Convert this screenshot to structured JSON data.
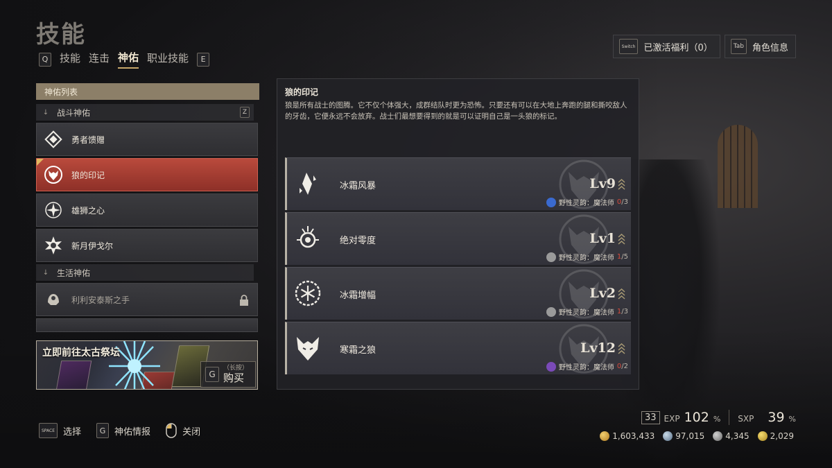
{
  "header": {
    "title": "技能",
    "tabs": [
      {
        "key": "Q"
      },
      {
        "label": "技能"
      },
      {
        "label": "连击"
      },
      {
        "label": "神佑"
      },
      {
        "label": "职业技能"
      },
      {
        "key": "E"
      }
    ],
    "active_tab": "神佑"
  },
  "top_right": {
    "benefits": {
      "key": "Switch",
      "label": "已激活福利（0）"
    },
    "character": {
      "key": "Tab",
      "label": "角色信息"
    }
  },
  "blessing_list": {
    "header": "神佑列表",
    "categories": [
      {
        "name": "战斗神佑",
        "key": "Z",
        "items": [
          {
            "name": "勇者馈赠",
            "icon": "diamond-emblem-icon",
            "selected": false,
            "locked": false
          },
          {
            "name": "狼的印记",
            "icon": "wolf-head-icon",
            "selected": true,
            "locked": false
          },
          {
            "name": "雄狮之心",
            "icon": "sun-star-icon",
            "selected": false,
            "locked": false
          },
          {
            "name": "新月伊戈尔",
            "icon": "spiked-sun-icon",
            "selected": false,
            "locked": false
          }
        ]
      },
      {
        "name": "生活神佑",
        "items": [
          {
            "name": "利利安泰斯之手",
            "icon": "hand-bloom-icon",
            "selected": false,
            "locked": true
          }
        ]
      }
    ]
  },
  "banner": {
    "title": "立即前往太古祭坛",
    "buy_key": "G",
    "buy_hint": "（长按）",
    "buy_label": "购买"
  },
  "bottom_hints": [
    {
      "key": "SPACE",
      "label": "选择"
    },
    {
      "key": "G",
      "label": "神佑情报"
    },
    {
      "key": "mouse-icon",
      "label": "关闭"
    }
  ],
  "detail": {
    "title": "狼的印记",
    "description": "狼是所有战士的图腾。它不仅个体强大，成群结队时更为恐怖。只要还有可以在大地上奔跑的腿和撕咬敌人的牙齿，它便永远不会放弃。战士们最想要得到的就是可以证明自己是一头狼的标记。",
    "abilities": [
      {
        "name": "冰霜风暴",
        "level": "Lv9",
        "icon": "ice-crystal-icon",
        "req_label": "野性灵韵：魔法师",
        "req_current": "0",
        "req_max": "/3",
        "req_color": "#3a6ad0"
      },
      {
        "name": "绝对零度",
        "level": "Lv1",
        "icon": "frost-orb-icon",
        "req_label": "野性灵韵：魔法师",
        "req_current": "1",
        "req_max": "/5",
        "req_color": "#9a9a9a"
      },
      {
        "name": "冰霜增幅",
        "level": "Lv2",
        "icon": "snowflake-ring-icon",
        "req_label": "野性灵韵：魔法师",
        "req_current": "1",
        "req_max": "/3",
        "req_color": "#9a9a9a"
      },
      {
        "name": "寒霜之狼",
        "level": "Lv12",
        "icon": "frost-wolf-icon",
        "req_label": "野性灵韵：魔法师",
        "req_current": "0",
        "req_max": "/2",
        "req_color": "#7a4ab8"
      }
    ]
  },
  "stats": {
    "level": "33",
    "exp_label": "EXP",
    "exp_value": "102",
    "exp_unit": "%",
    "sxp_label": "SXP",
    "sxp_value": "39",
    "sxp_unit": "%"
  },
  "currencies": [
    {
      "value": "1,603,433",
      "icon": "gold-coin-icon",
      "color": "#d9a640"
    },
    {
      "value": "97,015",
      "icon": "silver-crystal-icon",
      "color": "#8fa4b8"
    },
    {
      "value": "4,345",
      "icon": "stone-icon",
      "color": "#9a9a9a"
    },
    {
      "value": "2,029",
      "icon": "gear-coin-icon",
      "color": "#d8b440"
    }
  ]
}
